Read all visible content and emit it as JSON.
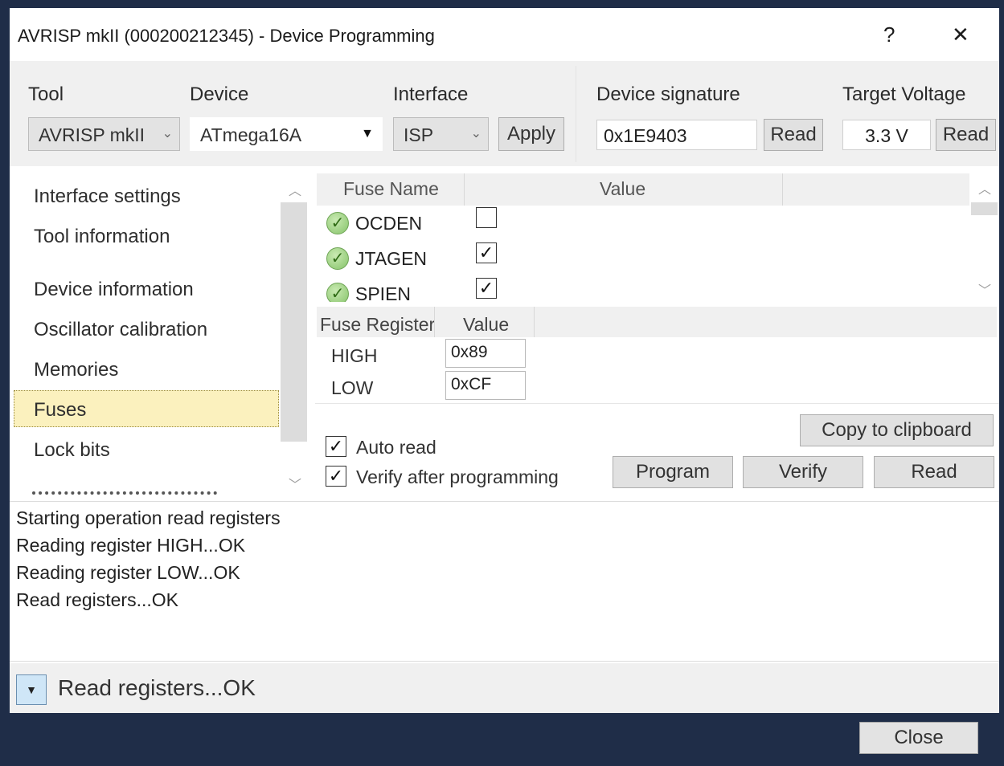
{
  "window": {
    "title": "AVRISP mkII (000200212345) - Device Programming",
    "help_label": "?",
    "close_glyph": "✕"
  },
  "toolbar": {
    "tool_label": "Tool",
    "tool_value": "AVRISP mkII",
    "device_label": "Device",
    "device_value": "ATmega16A",
    "interface_label": "Interface",
    "interface_value": "ISP",
    "apply_label": "Apply",
    "signature_label": "Device signature",
    "signature_value": "0x1E9403",
    "signature_read_label": "Read",
    "voltage_label": "Target Voltage",
    "voltage_value": "3.3 V",
    "voltage_read_label": "Read"
  },
  "sidebar": {
    "items": [
      {
        "label": "Interface settings"
      },
      {
        "label": "Tool information"
      },
      {
        "label": "Device information"
      },
      {
        "label": "Oscillator calibration"
      },
      {
        "label": "Memories"
      },
      {
        "label": "Fuses"
      },
      {
        "label": "Lock bits"
      }
    ],
    "selected": "Fuses"
  },
  "fuses": {
    "header_name": "Fuse Name",
    "header_value": "Value",
    "rows": [
      {
        "name": "OCDEN",
        "checked": false
      },
      {
        "name": "JTAGEN",
        "checked": true
      },
      {
        "name": "SPIEN",
        "checked": true
      }
    ]
  },
  "registers": {
    "header_name": "Fuse Register",
    "header_value": "Value",
    "rows": [
      {
        "name": "HIGH",
        "value": "0x89"
      },
      {
        "name": "LOW",
        "value": "0xCF"
      }
    ]
  },
  "controls": {
    "copy_label": "Copy to clipboard",
    "auto_read_label": "Auto read",
    "auto_read_checked": true,
    "verify_label": "Verify after programming",
    "verify_checked": true,
    "program_label": "Program",
    "verify_button_label": "Verify",
    "read_label": "Read"
  },
  "log": {
    "lines": [
      "Starting operation read registers",
      "Reading register HIGH...OK",
      "Reading register LOW...OK",
      "Read registers...OK"
    ]
  },
  "status": {
    "toggle_glyph": "▼",
    "text": "Read registers...OK"
  },
  "footer": {
    "close_label": "Close"
  },
  "colors": {
    "frame": "#1f2d48",
    "selection": "#fbf1be",
    "ok_green": "#86c36a"
  }
}
